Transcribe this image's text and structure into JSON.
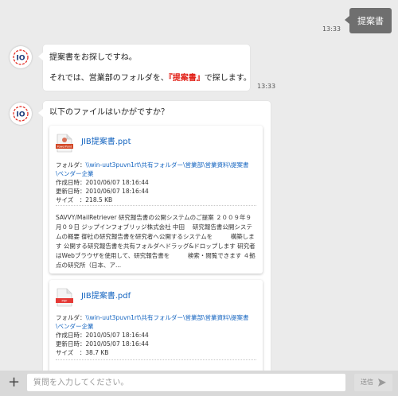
{
  "conversation": {
    "user_message": "提案書",
    "user_time": "13:33",
    "bot_message1": {
      "line1": "提案書をお探しですね。",
      "line2_pre": "それでは、営業部のフォルダを、",
      "line2_highlight": "『提案書』",
      "line2_post": "で探します。",
      "time": "13:33"
    },
    "bot_message2": {
      "text": "以下のファイルはいかがですか？"
    }
  },
  "files": [
    {
      "icon": "powerpoint-file-icon",
      "icon_label": "PowerPoint",
      "icon_color": "#d24726",
      "title": "JIB提案書.ppt",
      "folder_label": "フォルダ：",
      "folder_path": "\\\\win-uut3puvn1rt\\共有フォルダー\\営業部\\営業資料\\提案書\\ベンダー企業",
      "created_label": "作成日時：",
      "created": "2010/06/07 18:16:44",
      "updated_label": "更新日時：",
      "updated": "2010/06/07 18:16:44",
      "size_label": "サイズ　：",
      "size": "218.5 KB",
      "excerpt": "SAVVY/MailRetriever 研究報告書の公開システムのご提案 ２００９年９月０９日 ジップインフォブリッジ株式会社 中田　 研究報告書公開システムの概要 御社の研究報告書を研究者へ公開するシステムを　　　構築します 公開する研究報告書を共有フォルダへドラッグ&ドロップします 研究者はWebブラウザを使用して、研究報告書を　　　検索・閲覧できます ４拠点の研究所（日本、ア..."
    },
    {
      "icon": "pdf-file-icon",
      "icon_label": "PDF",
      "icon_color": "#e53935",
      "title": "JIB提案書.pdf",
      "folder_label": "フォルダ：",
      "folder_path": "\\\\win-uut3puvn1rt\\共有フォルダー\\営業部\\営業資料\\提案書\\ベンダー企業",
      "created_label": "作成日時：",
      "created": "2010/05/07 18:16:44",
      "updated_label": "更新日時：",
      "updated": "2010/05/07 18:16:44",
      "size_label": "サイズ　：",
      "size": "38.7 KB"
    }
  ],
  "input": {
    "add_icon": "plus-icon",
    "add_symbol": "+",
    "placeholder": "質問を入力してください。",
    "send_label": "送信",
    "send_icon": "send-arrow-icon"
  },
  "colors": {
    "background": "#ebebeb",
    "user_bubble": "#6f6f6f",
    "link": "#1565c0",
    "highlight": "#e2231a"
  }
}
